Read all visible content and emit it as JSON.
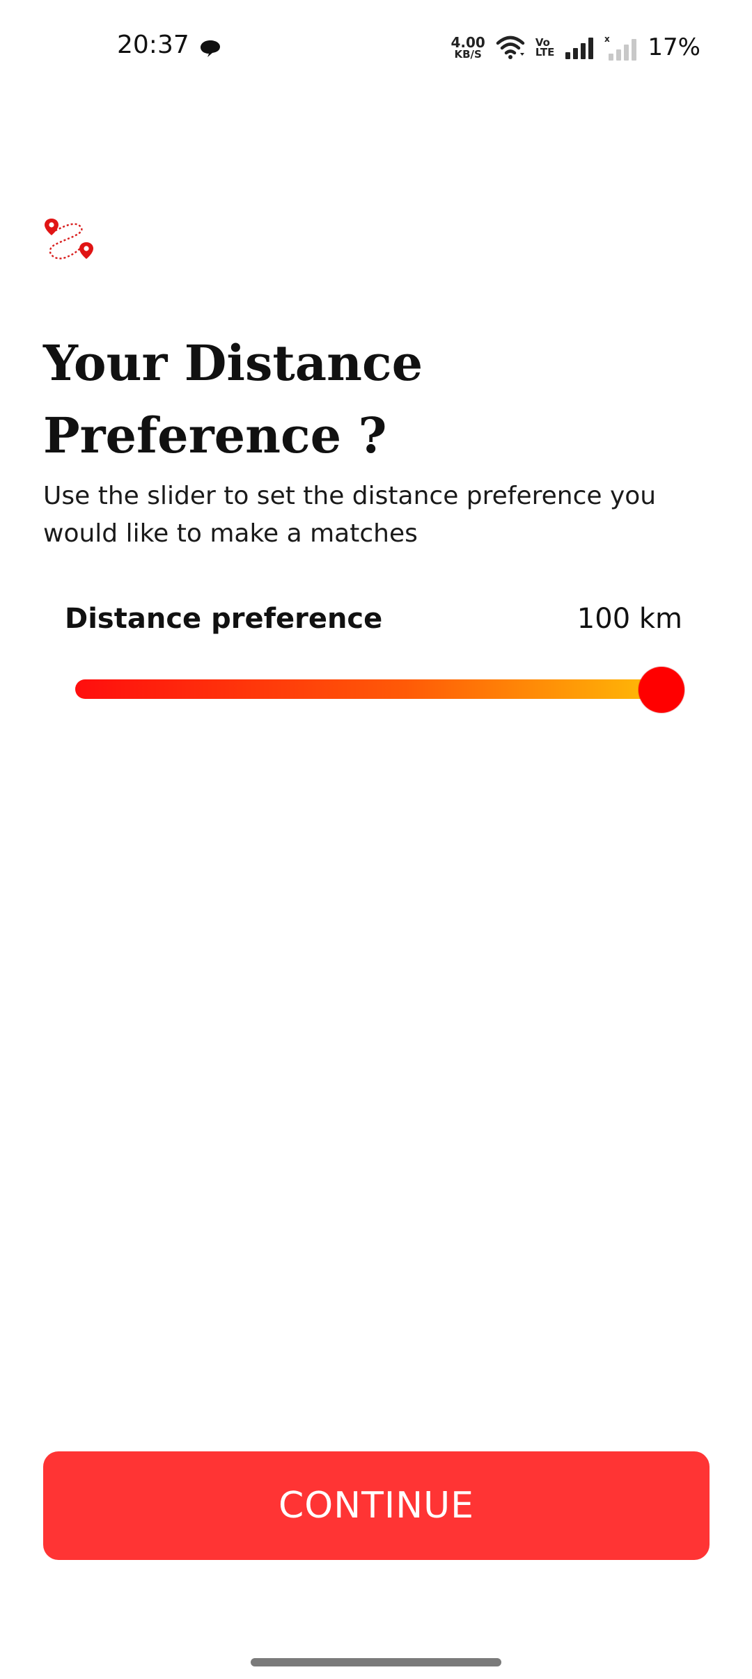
{
  "status_bar": {
    "time": "20:37",
    "net_speed_value": "4.00",
    "net_speed_unit": "KB/S",
    "volte_top": "Vo",
    "volte_bottom": "LTE",
    "battery": "17%",
    "icons": [
      "message-icon",
      "wifi-icon",
      "signal-icon",
      "signal-off-icon"
    ]
  },
  "header": {
    "icon": "route-pin-icon",
    "title": "Your Distance Preference ?",
    "subtitle": "Use the slider to set the distance preference you would like to make a matches"
  },
  "slider": {
    "label": "Distance preference",
    "value_text": "100 km",
    "value": 100,
    "min": 0,
    "max": 100,
    "colors": {
      "start": "#ff0e0e",
      "end": "#ffc107",
      "thumb": "#ff0000"
    }
  },
  "footer": {
    "continue_label": "CONTINUE",
    "button_color": "#ff3434"
  }
}
